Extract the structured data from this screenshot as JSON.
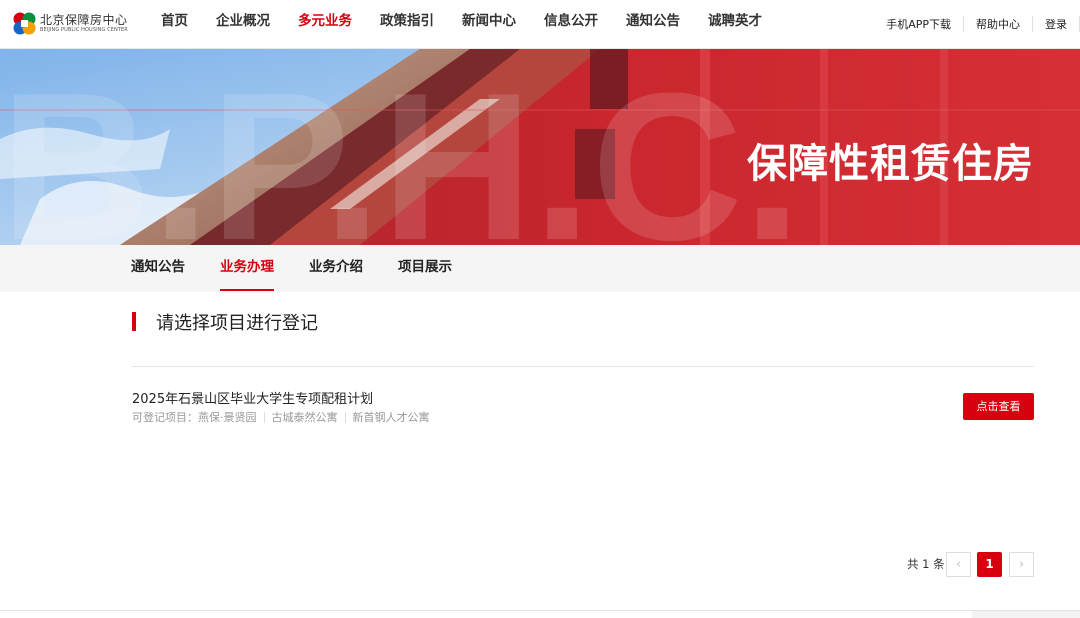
{
  "site": {
    "logo_cn": "北京保障房中心",
    "logo_en": "BEIJING PUBLIC HOUSING CENTER"
  },
  "nav": {
    "items": [
      {
        "label": "首页"
      },
      {
        "label": "企业概况"
      },
      {
        "label": "多元业务"
      },
      {
        "label": "政策指引"
      },
      {
        "label": "新闻中心"
      },
      {
        "label": "信息公开"
      },
      {
        "label": "通知公告"
      },
      {
        "label": "诚聘英才"
      }
    ],
    "active_index": 2
  },
  "util": {
    "app_download": "手机APP下载",
    "help": "帮助中心",
    "login": "登录"
  },
  "banner": {
    "title": "保障性租赁住房",
    "watermark": "B.P.H.C."
  },
  "subnav": {
    "items": [
      {
        "label": "通知公告"
      },
      {
        "label": "业务办理"
      },
      {
        "label": "业务介绍"
      },
      {
        "label": "项目展示"
      }
    ],
    "active_index": 1
  },
  "main": {
    "section_title": "请选择项目进行登记",
    "items": [
      {
        "title": "2025年石景山区毕业大学生专项配租计划",
        "meta_label": "可登记项目：",
        "projects": [
          "燕保·景贤园",
          "古城泰然公寓",
          "新首钢人才公寓"
        ],
        "button": "点击查看"
      }
    ]
  },
  "pagination": {
    "total": "共 1 条",
    "prev": "‹",
    "current": "1",
    "next": "›"
  },
  "colors": {
    "accent": "#d7000f",
    "subnav_bg": "#f5f5f5"
  }
}
